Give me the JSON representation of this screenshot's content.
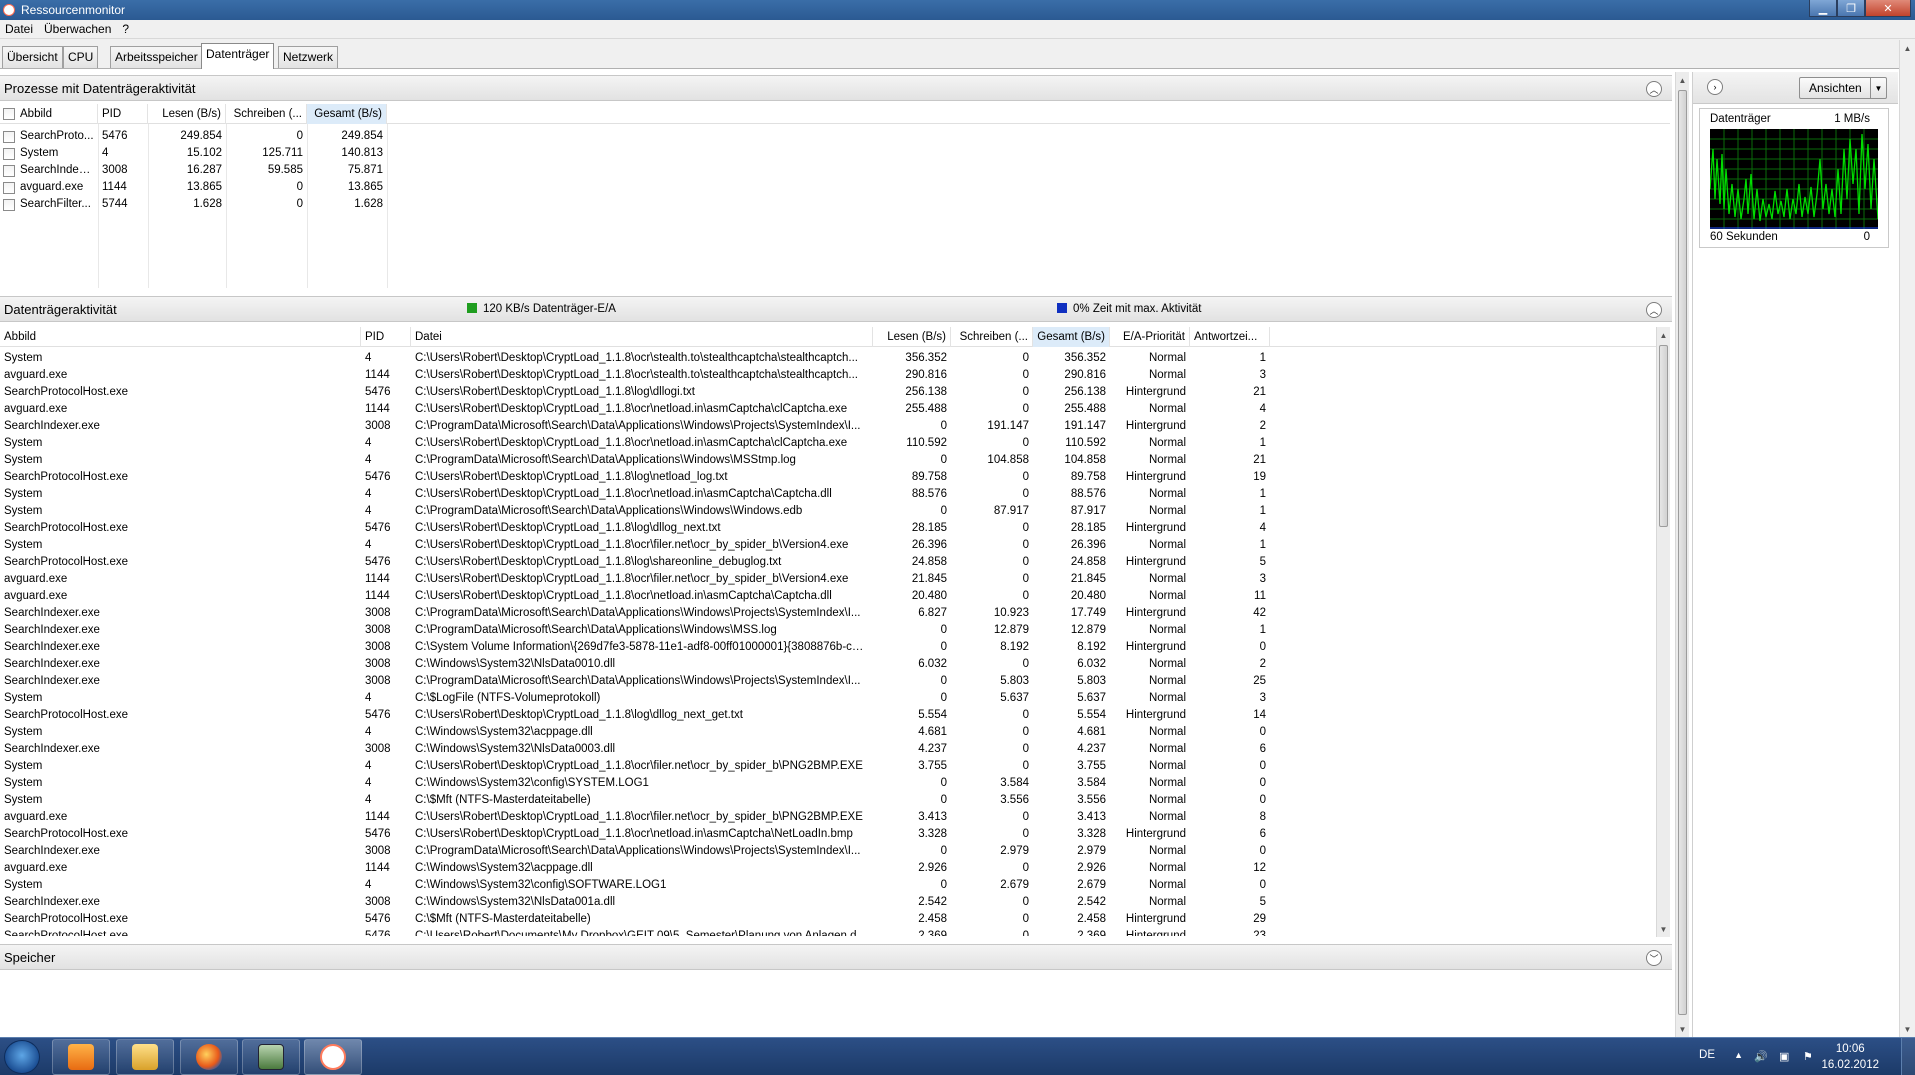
{
  "window": {
    "title": "Ressourcenmonitor"
  },
  "menu": [
    "Datei",
    "Überwachen",
    "?"
  ],
  "tabs": [
    "Übersicht",
    "CPU",
    "Arbeitsspeicher",
    "Datenträger",
    "Netzwerk"
  ],
  "active_tab": "Datenträger",
  "processes": {
    "title": "Prozesse mit Datenträgeraktivität",
    "columns": [
      "Abbild",
      "PID",
      "Lesen (B/s)",
      "Schreiben (...",
      "Gesamt (B/s)"
    ],
    "rows": [
      [
        "SearchProto...",
        "5476",
        "249.854",
        "0",
        "249.854"
      ],
      [
        "System",
        "4",
        "15.102",
        "125.711",
        "140.813"
      ],
      [
        "SearchIndex...",
        "3008",
        "16.287",
        "59.585",
        "75.871"
      ],
      [
        "avguard.exe",
        "1144",
        "13.865",
        "0",
        "13.865"
      ],
      [
        "SearchFilter...",
        "5744",
        "1.628",
        "0",
        "1.628"
      ]
    ]
  },
  "disk_activity": {
    "title": "Datenträgeraktivität",
    "legend_io": "120 KB/s Datenträger-E/A",
    "legend_time": "0% Zeit mit max. Aktivität",
    "legend_io_color": "#1f9d1f",
    "legend_time_color": "#1030c0",
    "columns": [
      "Abbild",
      "PID",
      "Datei",
      "Lesen (B/s)",
      "Schreiben (...",
      "Gesamt (B/s)",
      "E/A-Priorität",
      "Antwortzei..."
    ],
    "rows": [
      [
        "System",
        "4",
        "C:\\Users\\Robert\\Desktop\\CryptLoad_1.1.8\\ocr\\stealth.to\\stealthcaptcha\\stealthcaptch...",
        "356.352",
        "0",
        "356.352",
        "Normal",
        "1"
      ],
      [
        "avguard.exe",
        "1144",
        "C:\\Users\\Robert\\Desktop\\CryptLoad_1.1.8\\ocr\\stealth.to\\stealthcaptcha\\stealthcaptch...",
        "290.816",
        "0",
        "290.816",
        "Normal",
        "3"
      ],
      [
        "SearchProtocolHost.exe",
        "5476",
        "C:\\Users\\Robert\\Desktop\\CryptLoad_1.1.8\\log\\dllogi.txt",
        "256.138",
        "0",
        "256.138",
        "Hintergrund",
        "21"
      ],
      [
        "avguard.exe",
        "1144",
        "C:\\Users\\Robert\\Desktop\\CryptLoad_1.1.8\\ocr\\netload.in\\asmCaptcha\\clCaptcha.exe",
        "255.488",
        "0",
        "255.488",
        "Normal",
        "4"
      ],
      [
        "SearchIndexer.exe",
        "3008",
        "C:\\ProgramData\\Microsoft\\Search\\Data\\Applications\\Windows\\Projects\\SystemIndex\\I...",
        "0",
        "191.147",
        "191.147",
        "Hintergrund",
        "2"
      ],
      [
        "System",
        "4",
        "C:\\Users\\Robert\\Desktop\\CryptLoad_1.1.8\\ocr\\netload.in\\asmCaptcha\\clCaptcha.exe",
        "110.592",
        "0",
        "110.592",
        "Normal",
        "1"
      ],
      [
        "System",
        "4",
        "C:\\ProgramData\\Microsoft\\Search\\Data\\Applications\\Windows\\MSStmp.log",
        "0",
        "104.858",
        "104.858",
        "Normal",
        "21"
      ],
      [
        "SearchProtocolHost.exe",
        "5476",
        "C:\\Users\\Robert\\Desktop\\CryptLoad_1.1.8\\log\\netload_log.txt",
        "89.758",
        "0",
        "89.758",
        "Hintergrund",
        "19"
      ],
      [
        "System",
        "4",
        "C:\\Users\\Robert\\Desktop\\CryptLoad_1.1.8\\ocr\\netload.in\\asmCaptcha\\Captcha.dll",
        "88.576",
        "0",
        "88.576",
        "Normal",
        "1"
      ],
      [
        "System",
        "4",
        "C:\\ProgramData\\Microsoft\\Search\\Data\\Applications\\Windows\\Windows.edb",
        "0",
        "87.917",
        "87.917",
        "Normal",
        "1"
      ],
      [
        "SearchProtocolHost.exe",
        "5476",
        "C:\\Users\\Robert\\Desktop\\CryptLoad_1.1.8\\log\\dllog_next.txt",
        "28.185",
        "0",
        "28.185",
        "Hintergrund",
        "4"
      ],
      [
        "System",
        "4",
        "C:\\Users\\Robert\\Desktop\\CryptLoad_1.1.8\\ocr\\filer.net\\ocr_by_spider_b\\Version4.exe",
        "26.396",
        "0",
        "26.396",
        "Normal",
        "1"
      ],
      [
        "SearchProtocolHost.exe",
        "5476",
        "C:\\Users\\Robert\\Desktop\\CryptLoad_1.1.8\\log\\shareonline_debuglog.txt",
        "24.858",
        "0",
        "24.858",
        "Hintergrund",
        "5"
      ],
      [
        "avguard.exe",
        "1144",
        "C:\\Users\\Robert\\Desktop\\CryptLoad_1.1.8\\ocr\\filer.net\\ocr_by_spider_b\\Version4.exe",
        "21.845",
        "0",
        "21.845",
        "Normal",
        "3"
      ],
      [
        "avguard.exe",
        "1144",
        "C:\\Users\\Robert\\Desktop\\CryptLoad_1.1.8\\ocr\\netload.in\\asmCaptcha\\Captcha.dll",
        "20.480",
        "0",
        "20.480",
        "Normal",
        "11"
      ],
      [
        "SearchIndexer.exe",
        "3008",
        "C:\\ProgramData\\Microsoft\\Search\\Data\\Applications\\Windows\\Projects\\SystemIndex\\I...",
        "6.827",
        "10.923",
        "17.749",
        "Hintergrund",
        "42"
      ],
      [
        "SearchIndexer.exe",
        "3008",
        "C:\\ProgramData\\Microsoft\\Search\\Data\\Applications\\Windows\\MSS.log",
        "0",
        "12.879",
        "12.879",
        "Normal",
        "1"
      ],
      [
        "SearchIndexer.exe",
        "3008",
        "C:\\System Volume Information\\{269d7fe3-5878-11e1-adf8-00ff01000001}{3808876b-c17...",
        "0",
        "8.192",
        "8.192",
        "Hintergrund",
        "0"
      ],
      [
        "SearchIndexer.exe",
        "3008",
        "C:\\Windows\\System32\\NlsData0010.dll",
        "6.032",
        "0",
        "6.032",
        "Normal",
        "2"
      ],
      [
        "SearchIndexer.exe",
        "3008",
        "C:\\ProgramData\\Microsoft\\Search\\Data\\Applications\\Windows\\Projects\\SystemIndex\\I...",
        "0",
        "5.803",
        "5.803",
        "Normal",
        "25"
      ],
      [
        "System",
        "4",
        "C:\\$LogFile (NTFS-Volumeprotokoll)",
        "0",
        "5.637",
        "5.637",
        "Normal",
        "3"
      ],
      [
        "SearchProtocolHost.exe",
        "5476",
        "C:\\Users\\Robert\\Desktop\\CryptLoad_1.1.8\\log\\dllog_next_get.txt",
        "5.554",
        "0",
        "5.554",
        "Hintergrund",
        "14"
      ],
      [
        "System",
        "4",
        "C:\\Windows\\System32\\acppage.dll",
        "4.681",
        "0",
        "4.681",
        "Normal",
        "0"
      ],
      [
        "SearchIndexer.exe",
        "3008",
        "C:\\Windows\\System32\\NlsData0003.dll",
        "4.237",
        "0",
        "4.237",
        "Normal",
        "6"
      ],
      [
        "System",
        "4",
        "C:\\Users\\Robert\\Desktop\\CryptLoad_1.1.8\\ocr\\filer.net\\ocr_by_spider_b\\PNG2BMP.EXE",
        "3.755",
        "0",
        "3.755",
        "Normal",
        "0"
      ],
      [
        "System",
        "4",
        "C:\\Windows\\System32\\config\\SYSTEM.LOG1",
        "0",
        "3.584",
        "3.584",
        "Normal",
        "0"
      ],
      [
        "System",
        "4",
        "C:\\$Mft (NTFS-Masterdateitabelle)",
        "0",
        "3.556",
        "3.556",
        "Normal",
        "0"
      ],
      [
        "avguard.exe",
        "1144",
        "C:\\Users\\Robert\\Desktop\\CryptLoad_1.1.8\\ocr\\filer.net\\ocr_by_spider_b\\PNG2BMP.EXE",
        "3.413",
        "0",
        "3.413",
        "Normal",
        "8"
      ],
      [
        "SearchProtocolHost.exe",
        "5476",
        "C:\\Users\\Robert\\Desktop\\CryptLoad_1.1.8\\ocr\\netload.in\\asmCaptcha\\NetLoadIn.bmp",
        "3.328",
        "0",
        "3.328",
        "Hintergrund",
        "6"
      ],
      [
        "SearchIndexer.exe",
        "3008",
        "C:\\ProgramData\\Microsoft\\Search\\Data\\Applications\\Windows\\Projects\\SystemIndex\\I...",
        "0",
        "2.979",
        "2.979",
        "Normal",
        "0"
      ],
      [
        "avguard.exe",
        "1144",
        "C:\\Windows\\System32\\acppage.dll",
        "2.926",
        "0",
        "2.926",
        "Normal",
        "12"
      ],
      [
        "System",
        "4",
        "C:\\Windows\\System32\\config\\SOFTWARE.LOG1",
        "0",
        "2.679",
        "2.679",
        "Normal",
        "0"
      ],
      [
        "SearchIndexer.exe",
        "3008",
        "C:\\Windows\\System32\\NlsData001a.dll",
        "2.542",
        "0",
        "2.542",
        "Normal",
        "5"
      ],
      [
        "SearchProtocolHost.exe",
        "5476",
        "C:\\$Mft (NTFS-Masterdateitabelle)",
        "2.458",
        "0",
        "2.458",
        "Hintergrund",
        "29"
      ],
      [
        "SearchProtocolHost.exe",
        "5476",
        "C:\\Users\\Robert\\Documents\\My Dropbox\\GEIT 09\\5. Semester\\Planung von Anlagen d...",
        "2.369",
        "0",
        "2.369",
        "Hintergrund",
        "23"
      ]
    ]
  },
  "storage": {
    "title": "Speicher"
  },
  "right_panel": {
    "views_button": "Ansichten",
    "graph": {
      "title": "Datenträger",
      "max_label": "1 MB/s",
      "time_label": "60 Sekunden",
      "min_label": "0",
      "line_color": "#00cc00",
      "bg_color": "#000000"
    }
  },
  "taskbar": {
    "language": "DE",
    "time": "10:06",
    "date": "16.02.2012",
    "apps": [
      "media-player",
      "explorer",
      "firefox",
      "task-manager",
      "resource-monitor"
    ]
  }
}
